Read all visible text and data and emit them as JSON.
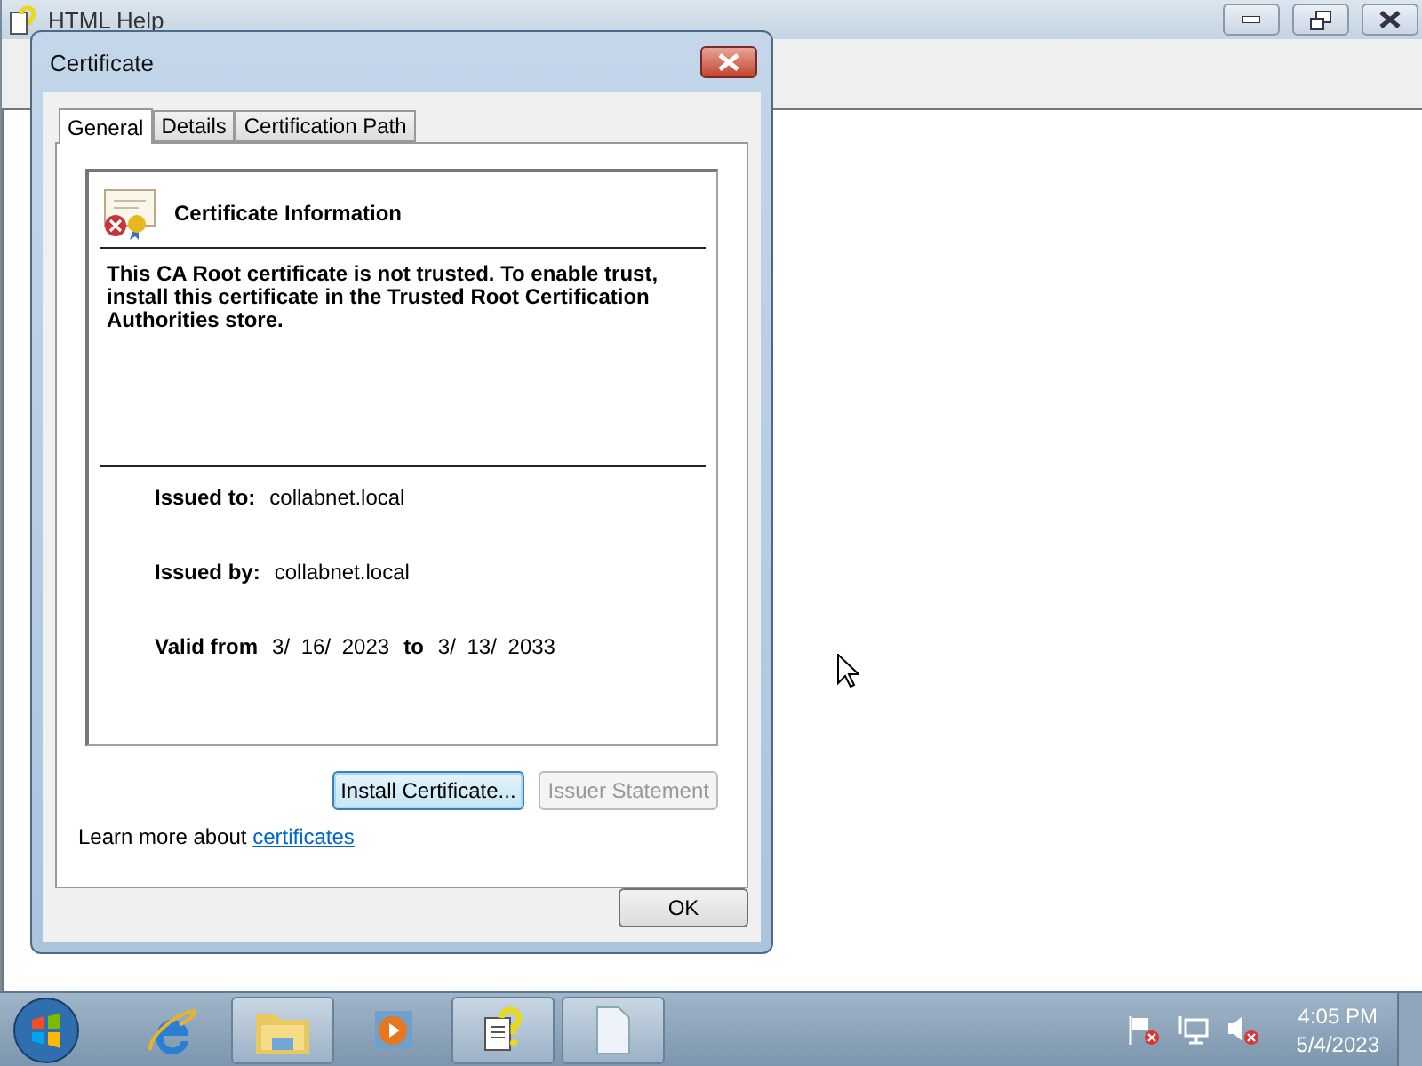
{
  "main_window": {
    "title": "HTML Help"
  },
  "dialog": {
    "title": "Certificate",
    "tabs": [
      {
        "label": "General",
        "selected": true
      },
      {
        "label": "Details",
        "selected": false
      },
      {
        "label": "Certification Path",
        "selected": false
      }
    ],
    "info_title": "Certificate Information",
    "message": "This CA Root certificate is not trusted. To enable trust, install this certificate in the Trusted Root Certification Authorities store.",
    "fields": [
      {
        "label": "Issued to:",
        "value": "collabnet.local"
      },
      {
        "label": "Issued by:",
        "value": "collabnet.local"
      }
    ],
    "validity": {
      "label": "Valid from",
      "from": "3/ 16/ 2023",
      "to_label": "to",
      "to": "3/ 13/ 2033"
    },
    "buttons": [
      {
        "label": "Install Certificate...",
        "disabled": false,
        "focused": true
      },
      {
        "label": "Issuer Statement",
        "disabled": true,
        "focused": false
      }
    ],
    "learn_more": {
      "text": "Learn more about",
      "link": "certificates"
    },
    "ok": "OK"
  },
  "taskbar": {
    "apps": [
      {
        "kind": "browser",
        "running": false
      },
      {
        "kind": "folder",
        "running": true
      },
      {
        "kind": "media",
        "running": false
      },
      {
        "kind": "help",
        "running": true
      },
      {
        "kind": "document",
        "running": true
      }
    ],
    "tray": [
      {
        "kind": "flag"
      },
      {
        "kind": "network"
      },
      {
        "kind": "speaker"
      }
    ],
    "clock": {
      "time": "4:05 PM",
      "date": "5/4/2023"
    }
  }
}
